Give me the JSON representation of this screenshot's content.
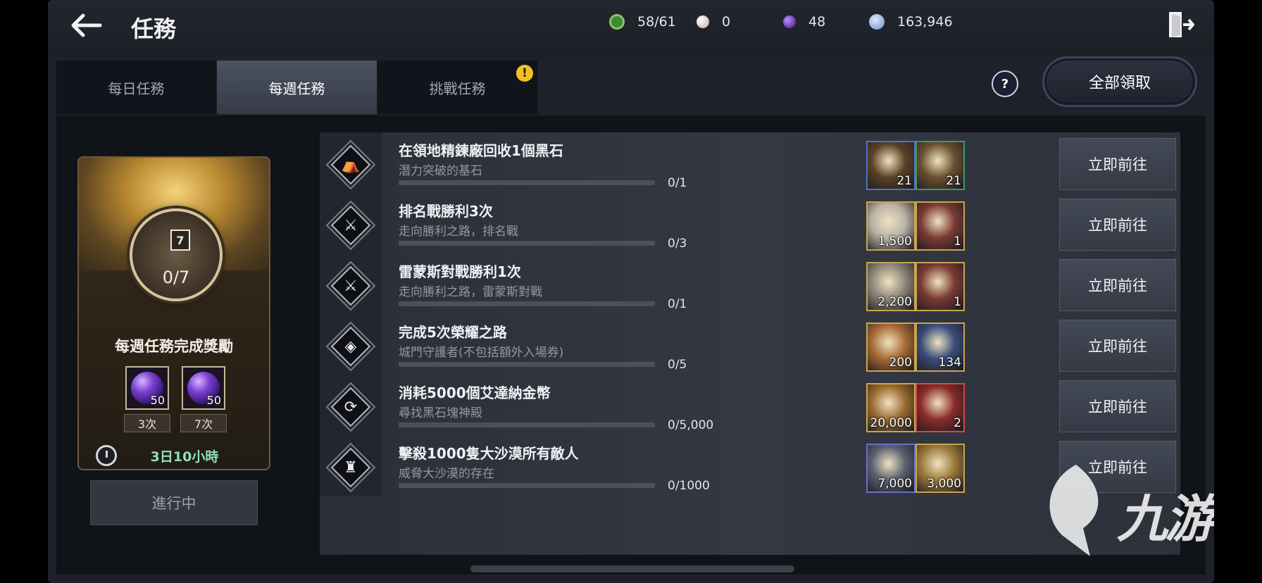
{
  "header": {
    "title": "任務",
    "resources": [
      {
        "name": "energy",
        "value": "58/61",
        "color": "#3f8a35",
        "icon": "leaf-coin-icon"
      },
      {
        "name": "pearl",
        "value": "0",
        "color": "#d9c5c4",
        "icon": "pearl-icon"
      },
      {
        "name": "black-stone",
        "value": "48",
        "color": "#5e35b8",
        "icon": "purple-orb-icon"
      },
      {
        "name": "silver",
        "value": "163,946",
        "color": "#8aa6d6",
        "icon": "silver-coin-icon"
      }
    ]
  },
  "tabs": [
    {
      "label": "每日任務",
      "active": false,
      "alert": false
    },
    {
      "label": "每週任務",
      "active": true,
      "alert": false
    },
    {
      "label": "挑戰任務",
      "active": false,
      "alert": true
    }
  ],
  "tab_alert_symbol": "!",
  "help_symbol": "?",
  "claim_all_label": "全部領取",
  "reward_panel": {
    "progress": "0/7",
    "badge_number": "7",
    "title": "每週任務完成獎勵",
    "rewards": [
      {
        "count": "50",
        "tier": "3次"
      },
      {
        "count": "50",
        "tier": "7次"
      }
    ],
    "timer": "3日10小時",
    "status_button": "進行中"
  },
  "tasks": [
    {
      "title": "在領地精鍊廠回收1個黑石",
      "subtitle": "潛力突破的基石",
      "progress": "0/1",
      "fraction": 0,
      "icon": "camp-tent-icon",
      "glyph": "⛺",
      "rewards": [
        {
          "qty": "21",
          "icon": "treasure-chest-icon",
          "border": "#4f74c7",
          "bg": "#5a4125"
        },
        {
          "qty": "21",
          "icon": "crate-icon",
          "border": "#3c9a6a",
          "bg": "#6a4f2e"
        }
      ]
    },
    {
      "title": "排名戰勝利3次",
      "subtitle": "走向勝利之路，排名戰",
      "progress": "0/3",
      "fraction": 0,
      "icon": "crossed-swords-icon",
      "glyph": "⚔",
      "rewards": [
        {
          "qty": "1,500",
          "icon": "scroll-banner-icon",
          "border": "#c9a64d",
          "bg": "#b9b3a6"
        },
        {
          "qty": "1",
          "icon": "medal-ribbon-icon",
          "border": "#c9a64d",
          "bg": "#7a3a33"
        }
      ]
    },
    {
      "title": "雷蒙斯對戰勝利1次",
      "subtitle": "走向勝利之路，雷蒙斯對戰",
      "progress": "0/1",
      "fraction": 0,
      "icon": "crossed-swords-icon",
      "glyph": "⚔",
      "rewards": [
        {
          "qty": "2,200",
          "icon": "plate-icon",
          "border": "#c9a64d",
          "bg": "#8d877a"
        },
        {
          "qty": "1",
          "icon": "medal-ribbon-icon",
          "border": "#c9a64d",
          "bg": "#7a3a33"
        }
      ]
    },
    {
      "title": "完成5次榮耀之路",
      "subtitle": "城門守護者(不包括額外入場券)",
      "progress": "0/5",
      "fraction": 0,
      "icon": "spiral-icon",
      "glyph": "◈",
      "rewards": [
        {
          "qty": "200",
          "icon": "bronze-coin-icon",
          "border": "#c9a64d",
          "bg": "#a86a34"
        },
        {
          "qty": "134",
          "icon": "crest-badge-icon",
          "border": "#c9a64d",
          "bg": "#3a4c7a"
        }
      ]
    },
    {
      "title": "消耗5000個艾達納金幣",
      "subtitle": "尋找黑石塊神殿",
      "progress": "0/5,000",
      "fraction": 0,
      "icon": "refresh-icon",
      "glyph": "⟳",
      "rewards": [
        {
          "qty": "20,000",
          "icon": "fire-ore-icon",
          "border": "#c9a64d",
          "bg": "#9a6a2e"
        },
        {
          "qty": "2",
          "icon": "red-scroll-icon",
          "border": "#d34848",
          "bg": "#8a2b2b"
        }
      ]
    },
    {
      "title": "擊殺1000隻大沙漠所有敵人",
      "subtitle": "威脅大沙漠的存在",
      "progress": "0/1000",
      "fraction": 0,
      "icon": "viking-helmet-icon",
      "glyph": "♜",
      "rewards": [
        {
          "qty": "7,000",
          "icon": "silver-bars-icon",
          "border": "#6b6fd0",
          "bg": "#5a6070"
        },
        {
          "qty": "3,000",
          "icon": "gold-coin-icon",
          "border": "#c9a64d",
          "bg": "#9a7a3a"
        }
      ]
    }
  ],
  "go_label": "立即前往",
  "watermark": "九游"
}
